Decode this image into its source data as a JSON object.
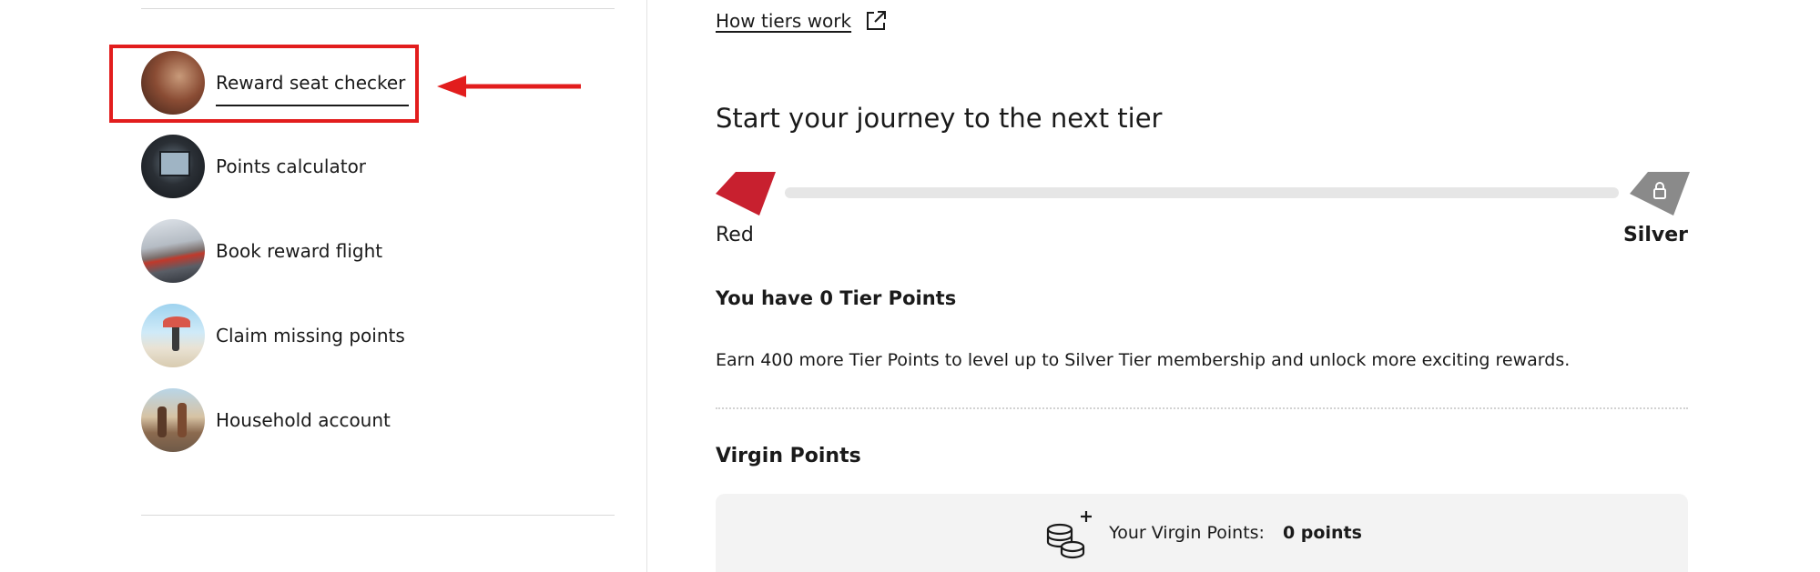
{
  "sidebar": {
    "items": [
      {
        "label": "Reward seat checker",
        "icon": "reward-seat-photo"
      },
      {
        "label": "Points calculator",
        "icon": "points-calculator-photo"
      },
      {
        "label": "Book reward flight",
        "icon": "book-flight-photo"
      },
      {
        "label": "Claim missing points",
        "icon": "claim-points-photo"
      },
      {
        "label": "Household account",
        "icon": "household-photo"
      }
    ]
  },
  "main": {
    "how_tiers_link": "How tiers work",
    "journey_heading": "Start your journey to the next tier",
    "tier_progress": {
      "current_tier": "Red",
      "next_tier": "Silver",
      "progress": 0,
      "current_color": "#c8202f",
      "next_color": "#8a8a8a"
    },
    "tier_points_text": "You have 0 Tier Points",
    "earn_text": "Earn 400 more Tier Points to level up to Silver Tier membership and unlock more exciting rewards.",
    "virgin_points_title": "Virgin Points",
    "virgin_points_label": "Your Virgin Points:",
    "virgin_points_value": "0 points"
  },
  "annotation": {
    "color": "#e21d1d"
  }
}
